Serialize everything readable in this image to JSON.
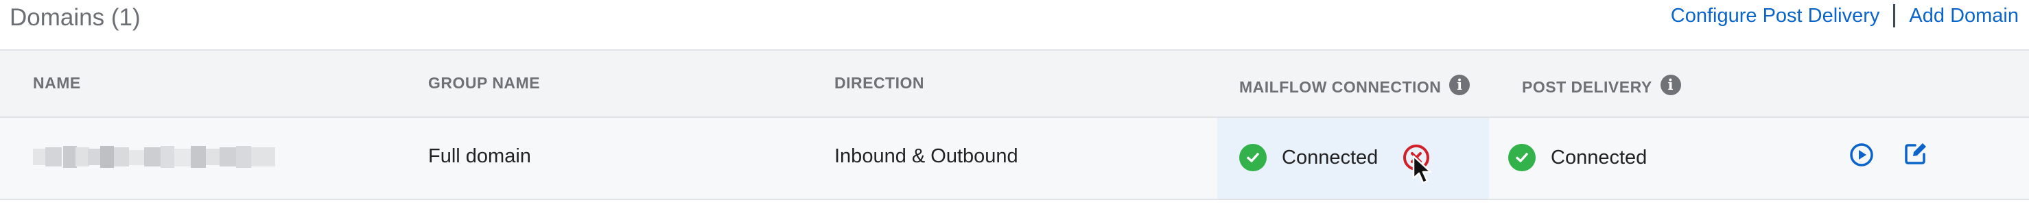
{
  "title": "Domains (1)",
  "links": {
    "configure": "Configure Post Delivery",
    "add": "Add Domain"
  },
  "columns": [
    "NAME",
    "GROUP NAME",
    "DIRECTION",
    "MAILFLOW CONNECTION",
    "POST DELIVERY"
  ],
  "rows": [
    {
      "name": "",
      "group": "Full domain",
      "direction": "Inbound & Outbound",
      "mailflow": "Connected",
      "post_delivery": "Connected"
    }
  ],
  "colors": {
    "link": "#0a64c9",
    "success": "#33b14a",
    "error": "#d0202a",
    "highlight": "#e9f1fb"
  }
}
